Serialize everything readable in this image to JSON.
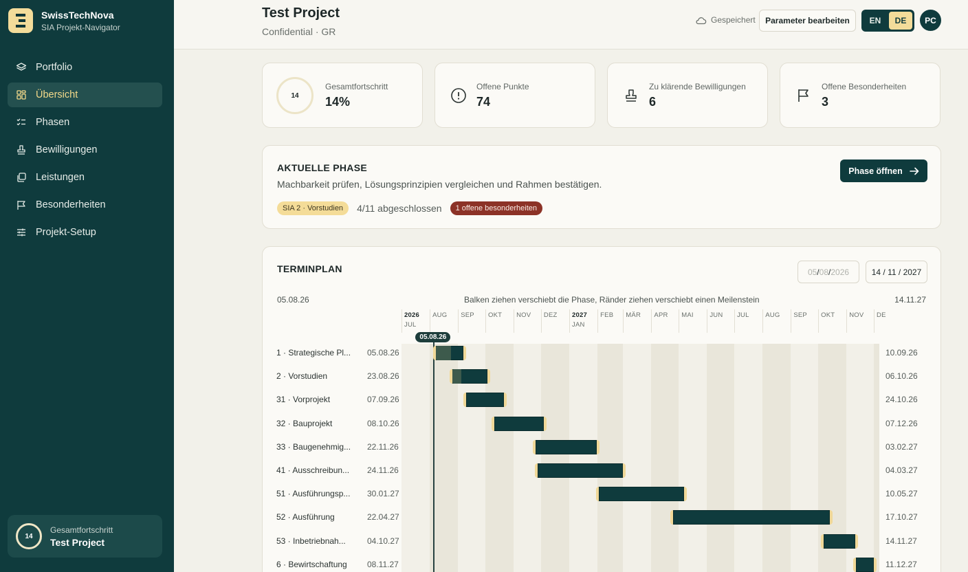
{
  "brand": {
    "name": "SwissTechNova",
    "subtitle": "SIA Projekt-Navigator"
  },
  "nav": [
    {
      "label": "Portfolio",
      "icon": "layers-icon"
    },
    {
      "label": "Übersicht",
      "icon": "grid-icon",
      "active": true
    },
    {
      "label": "Phasen",
      "icon": "checklist-icon"
    },
    {
      "label": "Bewilligungen",
      "icon": "stamp-icon"
    },
    {
      "label": "Leistungen",
      "icon": "copy-icon"
    },
    {
      "label": "Besonderheiten",
      "icon": "flag-icon"
    },
    {
      "label": "Projekt-Setup",
      "icon": "sliders-icon"
    }
  ],
  "sidebar_footer": {
    "progress": "14",
    "label": "Gesamtfortschritt",
    "title": "Test Project"
  },
  "header": {
    "title": "Test Project",
    "subtitle": "Confidential · GR",
    "saved": "Gespeichert",
    "edit_params": "Parameter bearbeiten",
    "lang_en": "EN",
    "lang_de": "DE",
    "active_lang": "DE",
    "avatar": "PC"
  },
  "stats": [
    {
      "label": "Gesamtfortschritt",
      "value": "14%",
      "ring": "14",
      "progress_fraction": 0.14
    },
    {
      "label": "Offene Punkte",
      "value": "74",
      "icon": "alert-circle-icon"
    },
    {
      "label": "Zu klärende Bewilligungen",
      "value": "6",
      "icon": "stamp-icon"
    },
    {
      "label": "Offene Besonderheiten",
      "value": "3",
      "icon": "flag-icon"
    }
  ],
  "current_phase": {
    "title": "AKTUELLE PHASE",
    "description": "Machbarkeit prüfen, Lösungsprinzipien vergleichen und Rahmen bestätigen.",
    "phase_badge": "SIA 2 · Vorstudien",
    "progress_text": "4/11 abgeschlossen",
    "issues_badge": "1 offene besonderheiten",
    "open_button": "Phase öffnen"
  },
  "schedule": {
    "title": "TERMINPLAN",
    "date_from_parts": [
      "05",
      "08",
      "2026"
    ],
    "date_to_parts": [
      "14",
      "11",
      "2027"
    ],
    "range_start": "05.08.26",
    "range_end": "14.11.27",
    "hint": "Balken ziehen verschiebt die Phase, Ränder ziehen verschiebt einen Meilenstein",
    "today_label": "05.08.26",
    "months": [
      {
        "label": "2026",
        "sub": "JUL",
        "year": true
      },
      {
        "label": "AUG"
      },
      {
        "label": "SEP"
      },
      {
        "label": "OKT"
      },
      {
        "label": "NOV"
      },
      {
        "label": "DEZ"
      },
      {
        "label": "2027",
        "sub": "JAN",
        "year": true
      },
      {
        "label": "FEB"
      },
      {
        "label": "MÄR"
      },
      {
        "label": "APR"
      },
      {
        "label": "MAI"
      },
      {
        "label": "JUN"
      },
      {
        "label": "JUL"
      },
      {
        "label": "AUG"
      },
      {
        "label": "SEP"
      },
      {
        "label": "OKT"
      },
      {
        "label": "NOV"
      },
      {
        "label": "DE"
      }
    ],
    "phases": [
      {
        "label": "1 · Strategische Pl...",
        "start": "05.08.26",
        "end": "10.09.26",
        "progress": 0.55
      },
      {
        "label": "2 · Vorstudien",
        "start": "23.08.26",
        "end": "06.10.26",
        "progress": 0.25
      },
      {
        "label": "31 · Vorprojekt",
        "start": "07.09.26",
        "end": "24.10.26",
        "progress": 0
      },
      {
        "label": "32 · Bauprojekt",
        "start": "08.10.26",
        "end": "07.12.26",
        "progress": 0
      },
      {
        "label": "33 · Baugenehmig...",
        "start": "22.11.26",
        "end": "03.02.27",
        "progress": 0
      },
      {
        "label": "41 · Ausschreibun...",
        "start": "24.11.26",
        "end": "04.03.27",
        "progress": 0
      },
      {
        "label": "51 · Ausführungsp...",
        "start": "30.01.27",
        "end": "10.05.27",
        "progress": 0
      },
      {
        "label": "52 · Ausführung",
        "start": "22.04.27",
        "end": "17.10.27",
        "progress": 0
      },
      {
        "label": "53 · Inbetriebnah...",
        "start": "04.10.27",
        "end": "14.11.27",
        "progress": 0
      },
      {
        "label": "6 · Bewirtschaftung",
        "start": "08.11.27",
        "end": "11.12.27",
        "progress": 0
      }
    ]
  },
  "colors": {
    "sidebar": "#0f3b3d",
    "accent": "#f3dc9a",
    "danger": "#8c3227"
  }
}
